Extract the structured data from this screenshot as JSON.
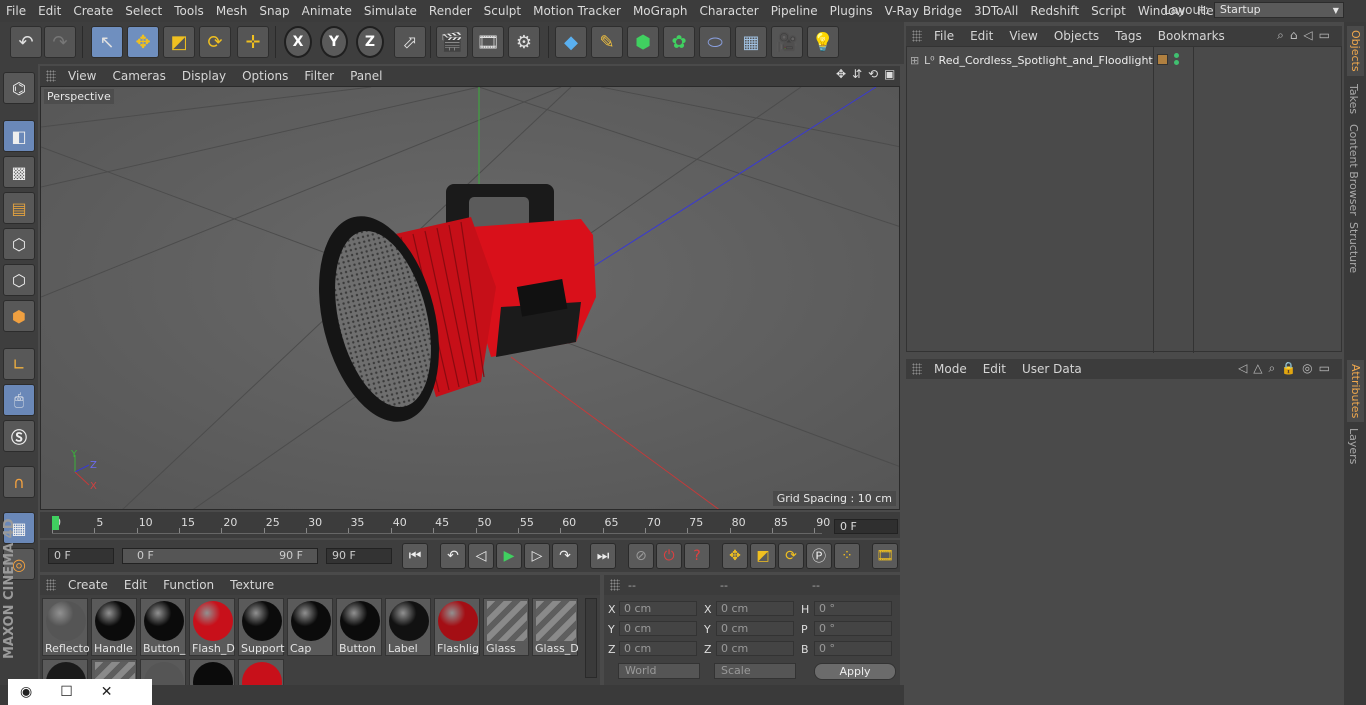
{
  "menubar": {
    "items": [
      "File",
      "Edit",
      "Create",
      "Select",
      "Tools",
      "Mesh",
      "Snap",
      "Animate",
      "Simulate",
      "Render",
      "Sculpt",
      "Motion Tracker",
      "MoGraph",
      "Character",
      "Pipeline",
      "Plugins",
      "V-Ray Bridge",
      "3DToAll",
      "Redshift",
      "Script",
      "Window",
      "Help"
    ],
    "layout_label": "Layout:",
    "layout_value": "Startup"
  },
  "toolbar": {
    "axis_x": "X",
    "axis_y": "Y",
    "axis_z": "Z"
  },
  "viewport": {
    "menu": [
      "View",
      "Cameras",
      "Display",
      "Options",
      "Filter",
      "Panel"
    ],
    "label": "Perspective",
    "grid_spacing": "Grid Spacing : 10 cm",
    "axis_labels": {
      "y": "Y",
      "z": "Z",
      "x": "X"
    },
    "colors": {
      "bg": "#5b5b5b",
      "grid": "#4f4f4f",
      "x_axis": "#c43a3a",
      "y_axis": "#3ab03a",
      "z_axis": "#3a3ad0",
      "model_red": "#d9101a",
      "model_black": "#1a1a1a"
    }
  },
  "timeline": {
    "ticks": [
      "0",
      "5",
      "10",
      "15",
      "20",
      "25",
      "30",
      "35",
      "40",
      "45",
      "50",
      "55",
      "60",
      "65",
      "70",
      "75",
      "80",
      "85",
      "90"
    ],
    "current_frame": "0 F",
    "start_field": "0 F",
    "range_start": "0 F",
    "range_end": "90 F",
    "end_field": "90 F"
  },
  "materials": {
    "menu": [
      "Create",
      "Edit",
      "Function",
      "Texture"
    ],
    "items": [
      {
        "name": "Reflecto",
        "color": "#555555"
      },
      {
        "name": "Handle",
        "color": "#0b0b0b"
      },
      {
        "name": "Button_",
        "color": "#0b0b0b"
      },
      {
        "name": "Flash_D",
        "color": "#c8101a"
      },
      {
        "name": "Support",
        "color": "#0b0b0b"
      },
      {
        "name": "Cap",
        "color": "#0b0b0b"
      },
      {
        "name": "Button",
        "color": "#0b0b0b"
      },
      {
        "name": "Label",
        "color": "#111111"
      },
      {
        "name": "Flashlig",
        "color": "#a40e14"
      },
      {
        "name": "Glass",
        "color": "striped"
      },
      {
        "name": "Glass_D",
        "color": "striped"
      }
    ]
  },
  "coordinates": {
    "headers": [
      "--",
      "--",
      "--"
    ],
    "rows": [
      {
        "l1": "X",
        "v1": "0 cm",
        "l2": "X",
        "v2": "0 cm",
        "l3": "H",
        "v3": "0 °"
      },
      {
        "l1": "Y",
        "v1": "0 cm",
        "l2": "Y",
        "v2": "0 cm",
        "l3": "P",
        "v3": "0 °"
      },
      {
        "l1": "Z",
        "v1": "0 cm",
        "l2": "Z",
        "v2": "0 cm",
        "l3": "B",
        "v3": "0 °"
      }
    ],
    "world": "World",
    "scale": "Scale",
    "apply": "Apply"
  },
  "objects": {
    "menu": [
      "File",
      "Edit",
      "View",
      "Objects",
      "Tags",
      "Bookmarks"
    ],
    "root_name": "Red_Cordless_Spotlight_and_Floodlight"
  },
  "attributes": {
    "menu": [
      "Mode",
      "Edit",
      "User Data"
    ]
  },
  "side_tabs": [
    "Objects",
    "Takes",
    "Content Browser",
    "Structure",
    "Attributes",
    "Layers"
  ],
  "branding": "MAXON CINEMA 4D"
}
